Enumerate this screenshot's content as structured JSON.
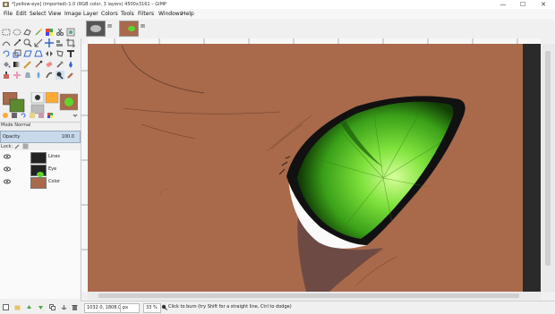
{
  "window": {
    "title": "*[yellow-eye] (imported)-1.0 (RGB color, 3 layers) 4500x3161 – GIMP",
    "minimize": "—",
    "maximize": "☐",
    "close": "✕"
  },
  "menu": {
    "items": [
      "File",
      "Edit",
      "Select",
      "View",
      "Image",
      "Layer",
      "Colors",
      "Tools",
      "Filters",
      "Windows",
      "Help"
    ]
  },
  "layers": {
    "mode_label": "Mode  Normal",
    "opacity_label": "Opacity",
    "opacity_value": "100.0",
    "lock_label": "Lock:",
    "rows": [
      {
        "name": "Lines"
      },
      {
        "name": "Eye"
      },
      {
        "name": "Color"
      }
    ]
  },
  "status": {
    "coords": "1032.0, 1808.0",
    "unit": "px",
    "zoom": "33 %",
    "message": "Click to burn (try Shift for a straight line, Ctrl to dodge)"
  },
  "colors": {
    "canvas_brown": "#a86a4b",
    "iris_green": "#5dd62b",
    "dark_panel": "#2a2a2a"
  }
}
